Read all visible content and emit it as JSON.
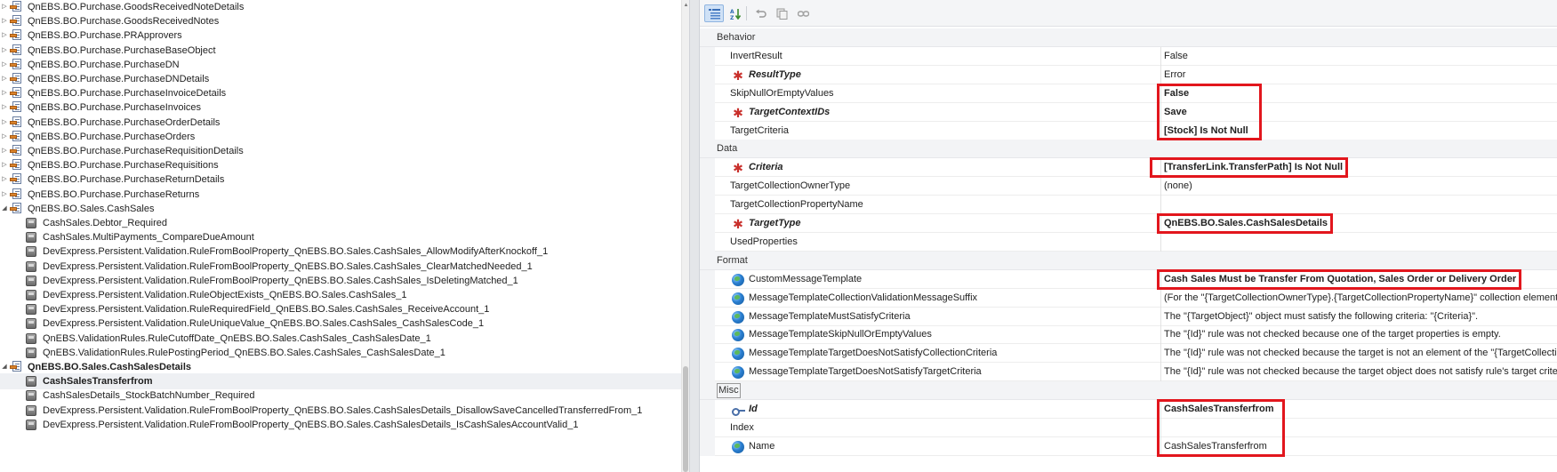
{
  "colors": {
    "highlight": "#e2161d",
    "category_bg": "#f3f4f6",
    "selected_row": "#eef0f3"
  },
  "tree": {
    "items": [
      {
        "label": "QnEBS.BO.Purchase.GoodsReceivedNoteDetails",
        "type": "class"
      },
      {
        "label": "QnEBS.BO.Purchase.GoodsReceivedNotes",
        "type": "class"
      },
      {
        "label": "QnEBS.BO.Purchase.PRApprovers",
        "type": "class"
      },
      {
        "label": "QnEBS.BO.Purchase.PurchaseBaseObject",
        "type": "class"
      },
      {
        "label": "QnEBS.BO.Purchase.PurchaseDN",
        "type": "class"
      },
      {
        "label": "QnEBS.BO.Purchase.PurchaseDNDetails",
        "type": "class"
      },
      {
        "label": "QnEBS.BO.Purchase.PurchaseInvoiceDetails",
        "type": "class"
      },
      {
        "label": "QnEBS.BO.Purchase.PurchaseInvoices",
        "type": "class"
      },
      {
        "label": "QnEBS.BO.Purchase.PurchaseOrderDetails",
        "type": "class"
      },
      {
        "label": "QnEBS.BO.Purchase.PurchaseOrders",
        "type": "class"
      },
      {
        "label": "QnEBS.BO.Purchase.PurchaseRequisitionDetails",
        "type": "class"
      },
      {
        "label": "QnEBS.BO.Purchase.PurchaseRequisitions",
        "type": "class"
      },
      {
        "label": "QnEBS.BO.Purchase.PurchaseReturnDetails",
        "type": "class"
      },
      {
        "label": "QnEBS.BO.Purchase.PurchaseReturns",
        "type": "class"
      },
      {
        "label": "QnEBS.BO.Sales.CashSales",
        "type": "class",
        "expanded": true
      },
      {
        "label": "CashSales.Debtor_Required",
        "type": "rule"
      },
      {
        "label": "CashSales.MultiPayments_CompareDueAmount",
        "type": "rule"
      },
      {
        "label": "DevExpress.Persistent.Validation.RuleFromBoolProperty_QnEBS.BO.Sales.CashSales_AllowModifyAfterKnockoff_1",
        "type": "rule"
      },
      {
        "label": "DevExpress.Persistent.Validation.RuleFromBoolProperty_QnEBS.BO.Sales.CashSales_ClearMatchedNeeded_1",
        "type": "rule"
      },
      {
        "label": "DevExpress.Persistent.Validation.RuleFromBoolProperty_QnEBS.BO.Sales.CashSales_IsDeletingMatched_1",
        "type": "rule"
      },
      {
        "label": "DevExpress.Persistent.Validation.RuleObjectExists_QnEBS.BO.Sales.CashSales_1",
        "type": "rule"
      },
      {
        "label": "DevExpress.Persistent.Validation.RuleRequiredField_QnEBS.BO.Sales.CashSales_ReceiveAccount_1",
        "type": "rule"
      },
      {
        "label": "DevExpress.Persistent.Validation.RuleUniqueValue_QnEBS.BO.Sales.CashSales_CashSalesCode_1",
        "type": "rule"
      },
      {
        "label": "QnEBS.ValidationRules.RuleCutoffDate_QnEBS.BO.Sales.CashSales_CashSalesDate_1",
        "type": "rule"
      },
      {
        "label": "QnEBS.ValidationRules.RulePostingPeriod_QnEBS.BO.Sales.CashSales_CashSalesDate_1",
        "type": "rule"
      },
      {
        "label": "QnEBS.BO.Sales.CashSalesDetails",
        "type": "class",
        "expanded": true,
        "bold": true
      },
      {
        "label": "CashSalesTransferfrom",
        "type": "rule",
        "bold": true,
        "selected": true
      },
      {
        "label": "CashSalesDetails_StockBatchNumber_Required",
        "type": "rule"
      },
      {
        "label": "DevExpress.Persistent.Validation.RuleFromBoolProperty_QnEBS.BO.Sales.CashSalesDetails_DisallowSaveCancelledTransferredFrom_1",
        "type": "rule"
      },
      {
        "label": "DevExpress.Persistent.Validation.RuleFromBoolProperty_QnEBS.BO.Sales.CashSalesDetails_IsCashSalesAccountValid_1",
        "type": "rule"
      }
    ]
  },
  "toolbar": {
    "buttons": [
      {
        "name": "categorized-view-button",
        "icon": "categorized-icon"
      },
      {
        "name": "alphabetical-sort-button",
        "icon": "sort-az-icon"
      },
      {
        "name": "undo-button",
        "icon": "undo-icon"
      },
      {
        "name": "copy-button",
        "icon": "copy-icon"
      },
      {
        "name": "link-button",
        "icon": "link-icon"
      }
    ]
  },
  "grid": {
    "categories": [
      {
        "label": "Behavior",
        "properties": [
          {
            "name": "InvertResult",
            "value": "False"
          },
          {
            "name": "ResultType",
            "value": "Error",
            "required": true
          },
          {
            "name": "SkipNullOrEmptyValues",
            "value": "False",
            "value_bold": true,
            "highlight": "behavior"
          },
          {
            "name": "TargetContextIDs",
            "value": "Save",
            "required": true,
            "value_bold": true,
            "highlight": "behavior"
          },
          {
            "name": "TargetCriteria",
            "value": "[Stock] Is Not Null",
            "value_bold": true,
            "highlight": "behavior"
          }
        ]
      },
      {
        "label": "Data",
        "properties": [
          {
            "name": "Criteria",
            "value": "[TransferLink.TransferPath] Is Not Null",
            "required": true,
            "value_bold": true,
            "highlight": "criteria"
          },
          {
            "name": "TargetCollectionOwnerType",
            "value": "(none)"
          },
          {
            "name": "TargetCollectionPropertyName",
            "value": ""
          },
          {
            "name": "TargetType",
            "value": "QnEBS.BO.Sales.CashSalesDetails",
            "required": true,
            "value_bold": true,
            "highlight": "targettype"
          },
          {
            "name": "UsedProperties",
            "value": ""
          }
        ]
      },
      {
        "label": "Format",
        "properties": [
          {
            "name": "CustomMessageTemplate",
            "value": "Cash Sales Must be Transfer From Quotation, Sales Order or Delivery Order",
            "icon": "globe",
            "value_bold": true,
            "highlight": "message"
          },
          {
            "name": "MessageTemplateCollectionValidationMessageSuffix",
            "value": "(For the \"{TargetCollectionOwnerType}.{TargetCollectionPropertyName}\" collection elements)",
            "icon": "globe"
          },
          {
            "name": "MessageTemplateMustSatisfyCriteria",
            "value": "The \"{TargetObject}\" object must satisfy the following criteria: \"{Criteria}\".",
            "icon": "globe"
          },
          {
            "name": "MessageTemplateSkipNullOrEmptyValues",
            "value": "The \"{Id}\" rule was not checked because one of the target properties is empty.",
            "icon": "globe"
          },
          {
            "name": "MessageTemplateTargetDoesNotSatisfyCollectionCriteria",
            "value": "The \"{Id}\" rule was not checked because the target is not an element of the \"{TargetCollectionOwnerType}.{TargetCollectionPropertyName}\" collection.",
            "icon": "globe"
          },
          {
            "name": "MessageTemplateTargetDoesNotSatisfyTargetCriteria",
            "value": "The \"{Id}\" rule was not checked because the target object does not satisfy rule's target criteria.",
            "icon": "globe"
          }
        ]
      },
      {
        "label": "Misc",
        "boxed": true,
        "properties": [
          {
            "name": "Id",
            "value": "CashSalesTransferfrom",
            "icon": "key",
            "name_bold": true,
            "value_bold": true,
            "highlight": "misc"
          },
          {
            "name": "Index",
            "value": "",
            "highlight": "misc"
          },
          {
            "name": "Name",
            "value": "CashSalesTransferfrom",
            "icon": "globe",
            "highlight": "misc"
          }
        ]
      }
    ]
  }
}
